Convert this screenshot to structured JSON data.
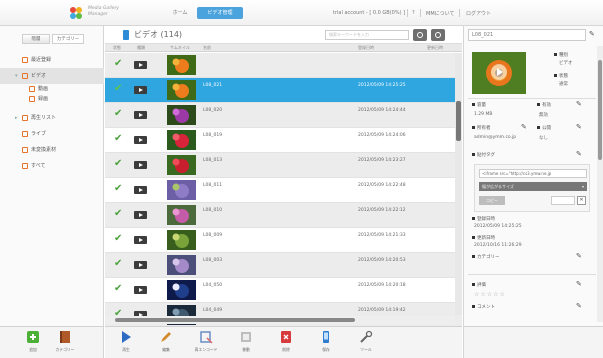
{
  "header": {
    "logo_line1": "Media Gallery",
    "logo_line2": "Manager",
    "nav_home": "ホーム",
    "nav_admin": "ビデオ管理",
    "account": "trial account - [ 0.0 GB(0%) ]",
    "help": "?",
    "about": "MMについて",
    "logout": "ログアウト"
  },
  "sidebar": {
    "tab_folder": "階層",
    "tab_category": "カテゴリー",
    "items": [
      {
        "label": "最近登録"
      },
      {
        "label": "ビデオ"
      },
      {
        "label": "動画"
      },
      {
        "label": "録画"
      },
      {
        "label": "再生リスト"
      },
      {
        "label": "ライブ"
      },
      {
        "label": "未変換素材"
      },
      {
        "label": "すべて"
      }
    ]
  },
  "list": {
    "title": "ビデオ (114)",
    "search_placeholder": "検索キーワードを入力",
    "columns": [
      "状態",
      "種類",
      "サムネイル",
      "名前",
      "登録日時",
      "更新日時"
    ],
    "rows": [
      {
        "name": "",
        "date": "",
        "thumb": "flower-orange"
      },
      {
        "name": "L08_021",
        "date": "2012/05/09 14:25:25",
        "thumb": "flower-orange"
      },
      {
        "name": "L08_020",
        "date": "2012/05/09 14:24:44",
        "thumb": "flower-purple"
      },
      {
        "name": "L08_019",
        "date": "2012/05/09 14:24:06",
        "thumb": "flower-red"
      },
      {
        "name": "L08_013",
        "date": "2012/05/09 14:23:27",
        "thumb": "flower-red2"
      },
      {
        "name": "L08_011",
        "date": "2012/05/09 14:22:48",
        "thumb": "field-purple"
      },
      {
        "name": "L08_010",
        "date": "2012/05/09 14:22:12",
        "thumb": "flower-pink"
      },
      {
        "name": "L08_009",
        "date": "2012/05/09 14:21:33",
        "thumb": "leaves-green"
      },
      {
        "name": "L08_003",
        "date": "2012/05/09 14:20:53",
        "thumb": "flower-lavender"
      },
      {
        "name": "L04_050",
        "date": "2012/05/09 14:20:18",
        "thumb": "night-blue"
      },
      {
        "name": "L04_049",
        "date": "2012/05/09 14:19:42",
        "thumb": "sky-dark"
      }
    ]
  },
  "detail": {
    "title": "L08_021",
    "type_label": "種別",
    "type_value": "ビデオ",
    "status_label": "状態",
    "status_value": "通常",
    "size_label": "容量",
    "size_value": "1.29 MB",
    "enabled_label": "有効",
    "enabled_value": "無効",
    "owner_label": "所有者",
    "owner_value": "admin@ymm.co.jp",
    "public_label": "公開",
    "public_value": "なし",
    "embed_label": "貼付タグ",
    "embed_code": "<iframe src=\"http://cs3.ymw.ne.jp",
    "embed_size": "幅が広がるサイズ",
    "copy_label": "コピー",
    "registered_label": "登録日時",
    "registered_value": "2012/05/09 14:25:25",
    "updated_label": "更新日時",
    "updated_value": "2012/10/16 11:26:29",
    "category_label": "カテゴリー",
    "rating_label": "評価",
    "rating_stars": "☆☆☆☆☆",
    "comment_label": "コメント"
  },
  "toolbar_left": [
    {
      "label": "追加",
      "icon": "add-green-icon",
      "color": "#4caf38"
    },
    {
      "label": "カテゴリー",
      "icon": "book-icon",
      "color": "#b05a2a"
    }
  ],
  "toolbar_center": [
    {
      "label": "再生",
      "icon": "play-icon",
      "color": "#2e6cc4"
    },
    {
      "label": "編集",
      "icon": "pencil-icon",
      "color": "#d28b2c"
    },
    {
      "label": "再エンコード",
      "icon": "encode-icon",
      "color": "#6b8fc4"
    },
    {
      "label": "移動",
      "icon": "move-icon",
      "color": "#bdbdbd"
    },
    {
      "label": "削除",
      "icon": "delete-icon",
      "color": "#d83b3b"
    },
    {
      "label": "保存",
      "icon": "phone-icon",
      "color": "#2e7dd1"
    },
    {
      "label": "ツール",
      "icon": "tools-icon",
      "color": "#666666"
    }
  ],
  "colors": {
    "accent": "#2fa6e0",
    "check": "#4ca23c",
    "tree_icon": "#e8742a"
  }
}
